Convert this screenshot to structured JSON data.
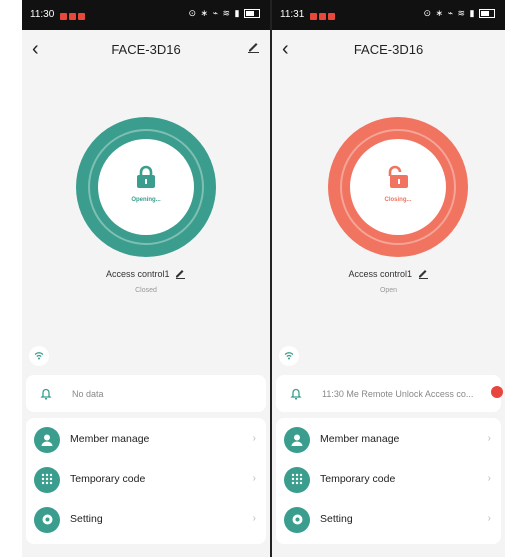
{
  "colors": {
    "unlocking_accent": "#3a9d8d",
    "locking_accent": "#f07460",
    "badge_red": "#e9453f"
  },
  "left": {
    "status_time": "11:30",
    "title": "FACE-3D16",
    "lock_icon": "lock-closed-icon",
    "state_label": "Opening...",
    "device_name": "Access control1",
    "device_status": "Closed",
    "notice": "No data",
    "menu": [
      {
        "label": "Member manage",
        "icon": "user-icon"
      },
      {
        "label": "Temporary code",
        "icon": "keypad-icon"
      },
      {
        "label": "Setting",
        "icon": "gear-icon"
      }
    ]
  },
  "right": {
    "status_time": "11:31",
    "title": "FACE-3D16",
    "lock_icon": "lock-open-icon",
    "state_label": "Closing...",
    "device_name": "Access control1",
    "device_status": "Open",
    "notice": "11:30 Me  Remote Unlock Access co...",
    "menu": [
      {
        "label": "Member manage",
        "icon": "user-icon"
      },
      {
        "label": "Temporary code",
        "icon": "keypad-icon"
      },
      {
        "label": "Setting",
        "icon": "gear-icon"
      }
    ]
  }
}
